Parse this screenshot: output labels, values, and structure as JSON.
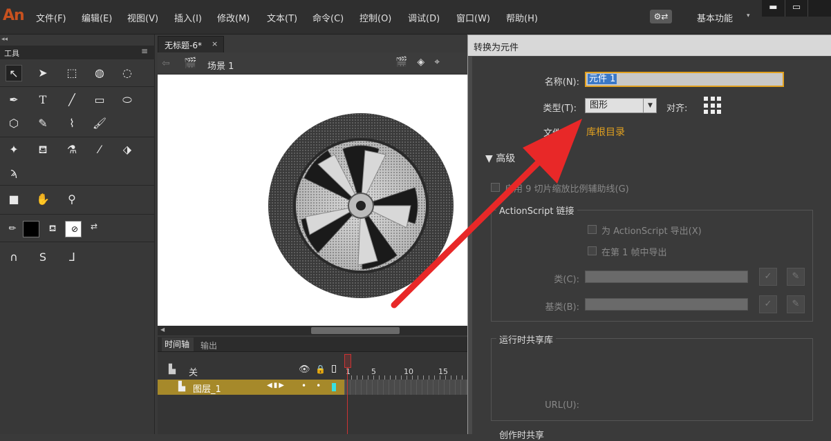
{
  "app": {
    "logo": "An",
    "menu": [
      "文件(F)",
      "编辑(E)",
      "视图(V)",
      "插入(I)",
      "修改(M)",
      "文本(T)",
      "命令(C)",
      "控制(O)",
      "调试(D)",
      "窗口(W)",
      "帮助(H)"
    ],
    "workspace": "基本功能",
    "workspace_arrow": "▾",
    "window_buttons": [
      "▬",
      "▭"
    ]
  },
  "tools_panel": {
    "title": "工具",
    "collapse": "◂◂",
    "menu": "≡"
  },
  "document": {
    "tab_label": "无标题-6*",
    "tab_close": "×",
    "scene_label": "场景 1"
  },
  "timeline": {
    "tab_timeline": "时间轴",
    "tab_output": "输出",
    "layer_group": "关",
    "layer_name": "图层_1",
    "ruler": [
      "1",
      "5",
      "10",
      "15"
    ]
  },
  "dialog": {
    "title": "转换为元件",
    "name_label": "名称(N):",
    "name_value": "元件 1",
    "type_label": "类型(T):",
    "type_value": "图形",
    "align_label": "对齐:",
    "folder_label": "文件",
    "folder_value": "库根目录",
    "advanced_label": "▼ 高级",
    "scale9_label": "启用 9 切片缩放比例辅助线(G)",
    "as_group": "ActionScript 链接",
    "export_as": "为 ActionScript 导出(X)",
    "export_frame1": "在第 1 帧中导出",
    "class_label": "类(C):",
    "base_class_label": "基类(B):",
    "runtime_group": "运行时共享库",
    "url_label": "URL(U):",
    "authoring_group": "创作时共享"
  },
  "colors": {
    "accent_orange": "#e0a020",
    "layer_highlight": "#a6892a",
    "arrow_red": "#e82828"
  }
}
